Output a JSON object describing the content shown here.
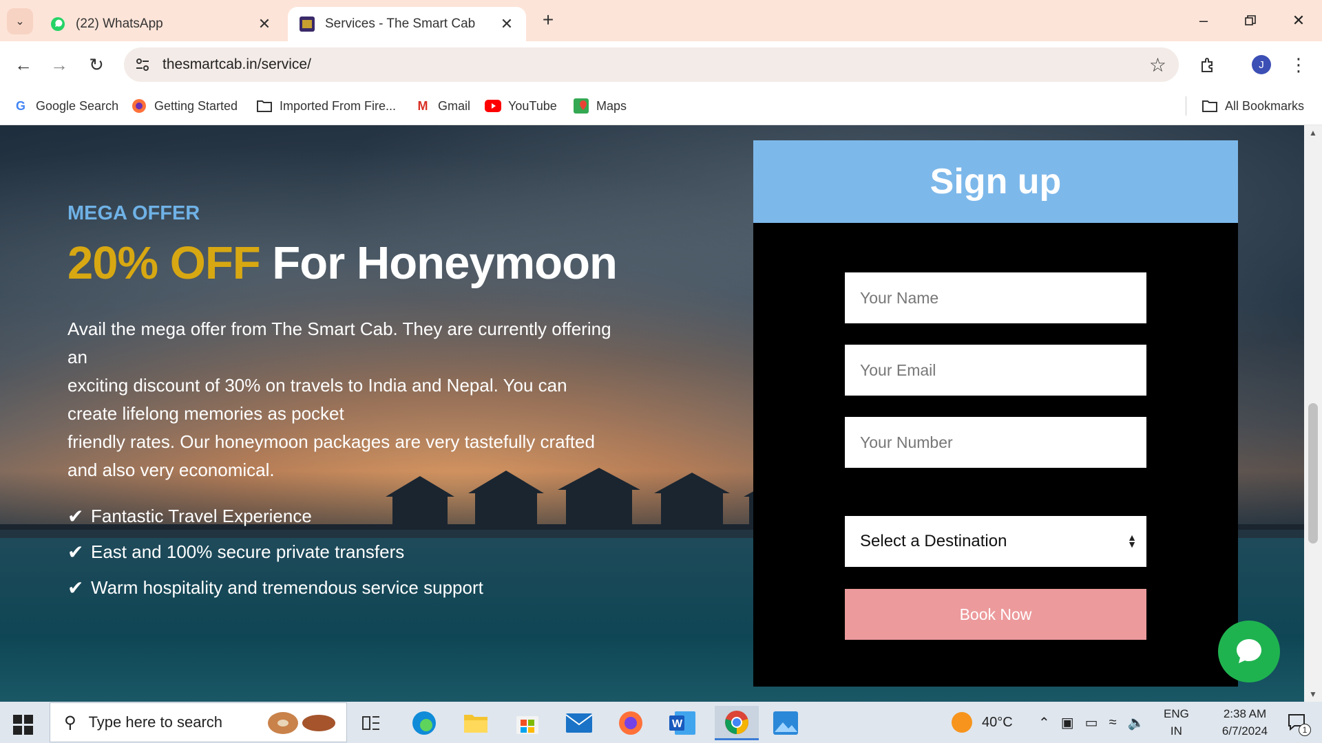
{
  "browser": {
    "tabs": [
      {
        "title": "(22) WhatsApp",
        "active": false
      },
      {
        "title": "Services - The Smart Cab",
        "active": true
      }
    ],
    "url": "thesmartcab.in/service/",
    "profile_initial": "J",
    "bookmarks": [
      {
        "label": "Google Search",
        "icon": "google-icon"
      },
      {
        "label": "Getting Started",
        "icon": "firefox-icon"
      },
      {
        "label": "Imported From Fire...",
        "icon": "folder-icon"
      },
      {
        "label": "Gmail",
        "icon": "gmail-icon"
      },
      {
        "label": "YouTube",
        "icon": "youtube-icon"
      },
      {
        "label": "Maps",
        "icon": "maps-icon"
      }
    ],
    "all_bookmarks": "All Bookmarks"
  },
  "hero": {
    "kicker": "MEGA OFFER",
    "headline_highlight": "20% OFF",
    "headline_rest": " For Honeymoon",
    "description_lines": [
      "Avail the mega offer from The Smart Cab. They are currently offering",
      "an",
      "exciting discount of 30% on travels to India and Nepal. You can",
      "create lifelong memories as pocket",
      "friendly rates. Our honeymoon packages are very tastefully crafted",
      "and also very economical."
    ],
    "features": [
      "Fantastic Travel Experience",
      "East and 100% secure private transfers",
      "Warm hospitality and tremendous service support"
    ]
  },
  "signup": {
    "title": "Sign up",
    "name_placeholder": "Your Name",
    "email_placeholder": "Your Email",
    "number_placeholder": "Your Number",
    "destination_selected": "Select a Destination",
    "book_label": "Book Now"
  },
  "taskbar": {
    "search_placeholder": "Type here to search",
    "temperature": "40°C",
    "language_top": "ENG",
    "language_bottom": "IN",
    "time": "2:38 AM",
    "date": "6/7/2024",
    "notification_count": "1"
  },
  "colors": {
    "accent_blue": "#7db8ea",
    "offer_yellow": "#d8a812",
    "button_pink": "#ec9a9c",
    "chat_green": "#1fb350"
  }
}
